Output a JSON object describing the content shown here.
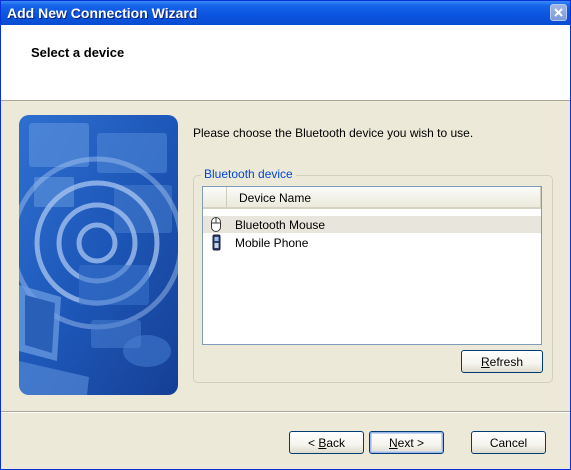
{
  "window": {
    "title": "Add New Connection Wizard"
  },
  "header": {
    "title": "Select a device"
  },
  "main": {
    "instruction": "Please choose the Bluetooth device you wish to use.",
    "group_label": "Bluetooth device",
    "list": {
      "column_header": "Device Name",
      "items": [
        {
          "name": "Bluetooth Mouse",
          "icon": "mouse-icon",
          "selected": true
        },
        {
          "name": "Mobile Phone",
          "icon": "mobile-phone-icon",
          "selected": false
        }
      ]
    },
    "refresh_button": {
      "mnemonic": "R",
      "rest": "efresh"
    }
  },
  "footer": {
    "back_button": {
      "prefix": "< ",
      "mnemonic": "B",
      "rest": "ack"
    },
    "next_button": {
      "mnemonic": "N",
      "rest": "ext >"
    },
    "cancel_label": "Cancel"
  },
  "colors": {
    "title_bar": "#0b55e0",
    "dialog_face": "#ece9d8",
    "group_label": "#0046d5",
    "selected_row": "#e8e6dc"
  }
}
